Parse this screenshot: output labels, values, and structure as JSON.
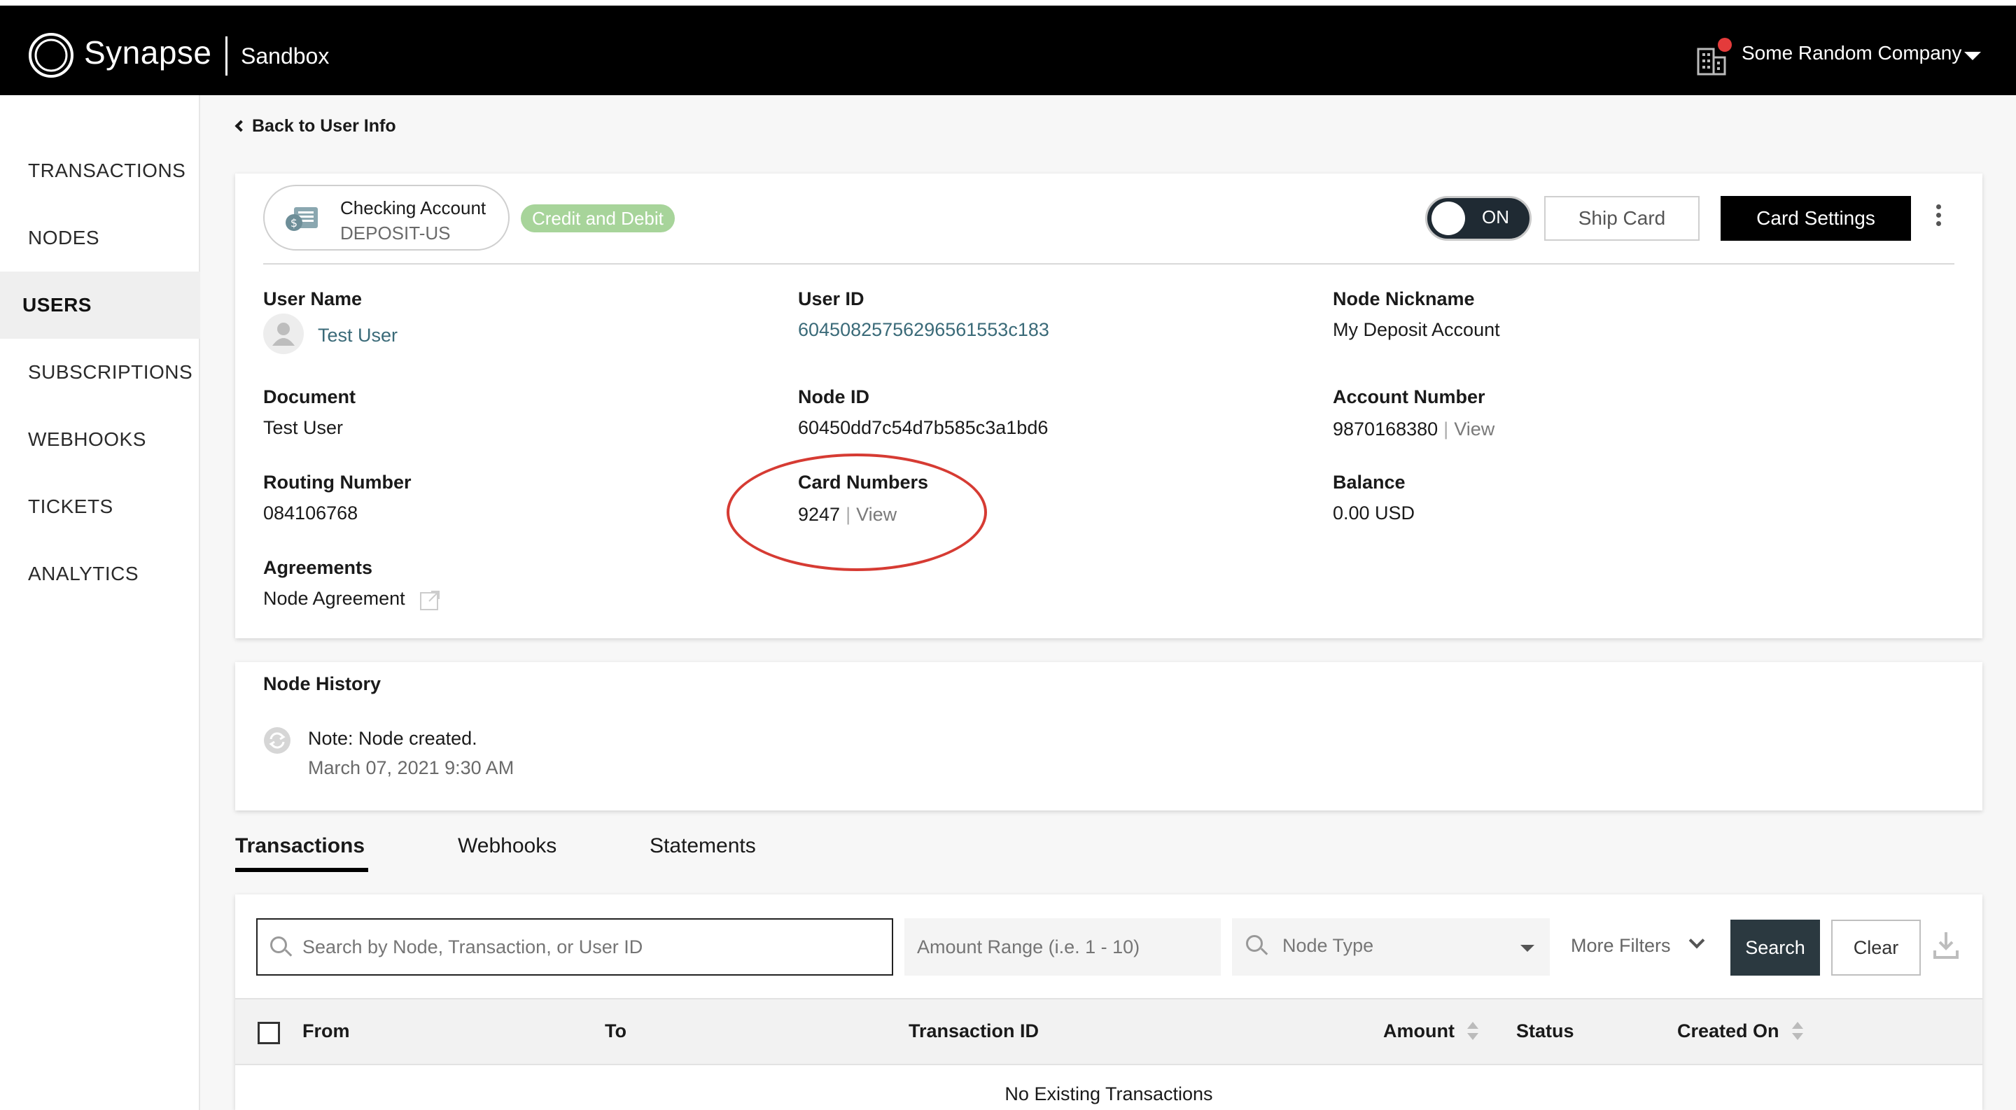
{
  "header": {
    "brand": "Synapse",
    "environment": "Sandbox",
    "company": "Some Random Company",
    "colors": {
      "bar": "#000000",
      "notification": "#e43b3b"
    }
  },
  "sidebar": {
    "items": [
      {
        "label": "TRANSACTIONS",
        "active": false
      },
      {
        "label": "NODES",
        "active": false
      },
      {
        "label": "USERS",
        "active": true
      },
      {
        "label": "SUBSCRIPTIONS",
        "active": false
      },
      {
        "label": "WEBHOOKS",
        "active": false
      },
      {
        "label": "TICKETS",
        "active": false
      },
      {
        "label": "ANALYTICS",
        "active": false
      }
    ]
  },
  "back_link": "Back to User Info",
  "node": {
    "account_name": "Checking Account",
    "account_type": "DEPOSIT-US",
    "badge": "Credit and Debit",
    "toggle_label": "ON",
    "ship_card": "Ship Card",
    "card_settings": "Card Settings",
    "fields": {
      "user_name_label": "User Name",
      "user_name": "Test User",
      "user_id_label": "User ID",
      "user_id": "60450825756296561553c183",
      "node_nickname_label": "Node Nickname",
      "node_nickname": "My Deposit Account",
      "document_label": "Document",
      "document": "Test User",
      "node_id_label": "Node ID",
      "node_id": "60450dd7c54d7b585c3a1bd6",
      "account_number_label": "Account Number",
      "account_number": "9870168380",
      "routing_number_label": "Routing Number",
      "routing_number": "084106768",
      "card_numbers_label": "Card Numbers",
      "card_numbers": "9247",
      "balance_label": "Balance",
      "balance": "0.00 USD",
      "agreements_label": "Agreements",
      "agreement": "Node Agreement",
      "view": "View",
      "separator": "|"
    }
  },
  "history": {
    "title": "Node History",
    "note": "Note: Node created.",
    "date": "March 07, 2021 9:30 AM"
  },
  "tabs": [
    {
      "label": "Transactions",
      "active": true
    },
    {
      "label": "Webhooks",
      "active": false
    },
    {
      "label": "Statements",
      "active": false
    }
  ],
  "filters": {
    "search_placeholder": "Search by Node, Transaction, or User ID",
    "amount_placeholder": "Amount Range (i.e. 1 - 10)",
    "node_type": "Node Type",
    "more_filters": "More Filters",
    "search_button": "Search",
    "clear_button": "Clear"
  },
  "table": {
    "columns": {
      "from": "From",
      "to": "To",
      "transaction_id": "Transaction ID",
      "amount": "Amount",
      "status": "Status",
      "created_on": "Created On"
    },
    "empty_message": "No Existing Transactions"
  }
}
